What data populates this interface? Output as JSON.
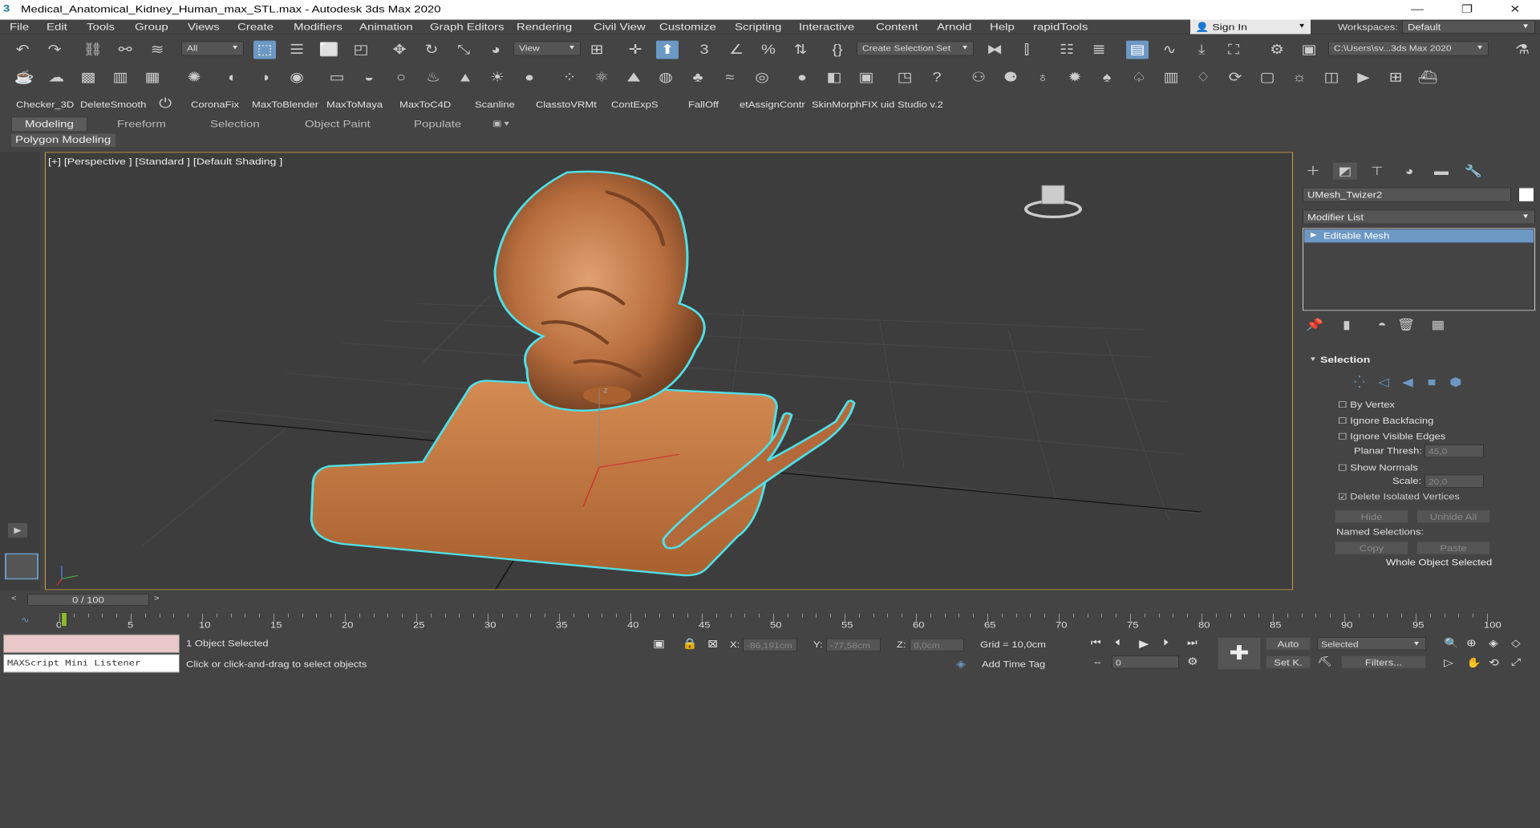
{
  "window": {
    "title": "Medical_Anatomical_Kidney_Human_max_STL.max - Autodesk 3ds Max 2020",
    "app_icon": "3"
  },
  "menu": [
    "File",
    "Edit",
    "Tools",
    "Group",
    "Views",
    "Create",
    "Modifiers",
    "Animation",
    "Graph Editors",
    "Rendering",
    "Civil View",
    "Customize",
    "Scripting",
    "Interactive",
    "Content",
    "Arnold",
    "Help",
    "rapidTools"
  ],
  "account": {
    "sign_in": "Sign In",
    "workspaces_label": "Workspaces:",
    "workspace": "Default"
  },
  "toolbar1": {
    "filter": "All",
    "view": "View",
    "selection_set": "Create Selection Set",
    "project_path": "C:\\Users\\sv...3ds Max 2020"
  },
  "shelf": [
    "Checker_3D",
    "DeleteSmooth",
    "CoronaFix",
    "MaxToBlender",
    "MaxToMaya",
    "MaxToC4D",
    "Scanline",
    "ClasstoVRMt",
    "ContExpS",
    "FallOff",
    "etAssignContr",
    "SkinMorphFIX",
    "uid Studio v.2"
  ],
  "ribbon": {
    "tabs": [
      "Modeling",
      "Freeform",
      "Selection",
      "Object Paint",
      "Populate"
    ],
    "active": "Modeling",
    "sub": "Polygon Modeling"
  },
  "viewport": {
    "label": "[+] [Perspective ] [Standard ] [Default Shading ]",
    "axis_z": "z",
    "object_color": "#c87a48",
    "selection_color": "#4fe0e8"
  },
  "command_panel": {
    "object_name": "UMesh_Twizer2",
    "modifier_list": "Modifier List",
    "stack_item": "Editable Mesh",
    "selection": {
      "title": "Selection",
      "by_vertex": "By Vertex",
      "ignore_backfacing": "Ignore Backfacing",
      "ignore_visible_edges": "Ignore Visible Edges",
      "planar_thresh_label": "Planar Thresh:",
      "planar_thresh": "45,0",
      "show_normals": "Show Normals",
      "scale_label": "Scale:",
      "scale": "20,0",
      "delete_isolated": "Delete Isolated Vertices",
      "hide": "Hide",
      "unhide_all": "Unhide All",
      "named_selections": "Named Selections:",
      "copy": "Copy",
      "paste": "Paste",
      "status": "Whole Object Selected"
    }
  },
  "timeline": {
    "frame": "0 / 100",
    "ticks": [
      "0",
      "5",
      "10",
      "15",
      "20",
      "25",
      "30",
      "35",
      "40",
      "45",
      "50",
      "55",
      "60",
      "65",
      "70",
      "75",
      "80",
      "85",
      "90",
      "95",
      "100"
    ]
  },
  "status": {
    "maxscript": "MAXScript Mini Listener",
    "selected": "1 Object Selected",
    "prompt": "Click or click-and-drag to select objects",
    "x_label": "X:",
    "x": "-86,191cm",
    "y_label": "Y:",
    "y": "-77,58cm",
    "z_label": "Z:",
    "z": "0,0cm",
    "grid": "Grid = 10,0cm",
    "add_time_tag": "Add Time Tag",
    "auto": "Auto",
    "set_key": "Set K.",
    "key_mode": "Selected",
    "filters": "Filters...",
    "current_frame": "0"
  }
}
